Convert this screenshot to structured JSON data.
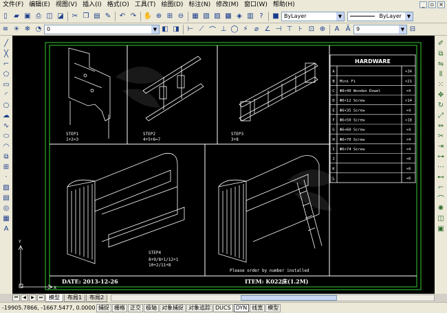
{
  "menu": [
    "文件(F)",
    "编辑(E)",
    "视图(V)",
    "插入(I)",
    "格式(O)",
    "工具(T)",
    "绘图(D)",
    "标注(N)",
    "修改(M)",
    "窗口(W)",
    "帮助(H)"
  ],
  "toolbar1": {
    "layer_select": "ByLayer",
    "linetype_select": "ByLayer"
  },
  "toolbar2": {
    "layer_name": "0",
    "textheight_select": "9"
  },
  "drawing": {
    "hardware_title": "HARDWARE",
    "hardware_rows": [
      {
        "id": "A",
        "desc": "",
        "qty": "×34"
      },
      {
        "id": "B",
        "desc": "Mini Fi",
        "qty": "×21"
      },
      {
        "id": "C",
        "desc": "Φ8×40 Wooden Dowel",
        "qty": "×4"
      },
      {
        "id": "D",
        "desc": "Φ6×12 Screw",
        "qty": "×14"
      },
      {
        "id": "E",
        "desc": "Φ6×35 Screw",
        "qty": "×4"
      },
      {
        "id": "F",
        "desc": "Φ6×50 Screw",
        "qty": "×18"
      },
      {
        "id": "G",
        "desc": "Φ6×60 Screw",
        "qty": "×4"
      },
      {
        "id": "H",
        "desc": "Φ6×70 Screw",
        "qty": "×4"
      },
      {
        "id": "I",
        "desc": "Φ6×74 Screw",
        "qty": "×4"
      },
      {
        "id": "J",
        "desc": "",
        "qty": "×0"
      },
      {
        "id": "K",
        "desc": "",
        "qty": "×0"
      },
      {
        "id": "L",
        "desc": "",
        "qty": "×0"
      }
    ],
    "step1_label": "STEP1",
    "step1_sub": "1+2=3",
    "step2_label": "STEP2",
    "step2_sub": "4+5+6=7",
    "step3_label": "STEP3",
    "step3_sub": "3+8",
    "step4_label": "STEP4",
    "step4_sub1": "8+9/8+1/12+1",
    "step4_sub2": "10+2/11+8",
    "note": "Please order by number installed",
    "date_label": "DATE:  2013-12-26",
    "item_label": "ITEM:  K022床(1.2M)"
  },
  "tabs": [
    "模型",
    "布局1",
    "布局2"
  ],
  "status": {
    "coords": "-19905.7866, -1667.5477, 0.0000",
    "buttons": [
      "捕捉",
      "栅格",
      "正交",
      "极轴",
      "对象捕捉",
      "对象追踪",
      "DUCS",
      "DYN",
      "线宽",
      "模型"
    ]
  },
  "colors": {
    "canvas_bg": "#000000",
    "frame_green": "#33cc33",
    "line_white": "#ffffff",
    "ui_bg": "#ece9d8"
  }
}
